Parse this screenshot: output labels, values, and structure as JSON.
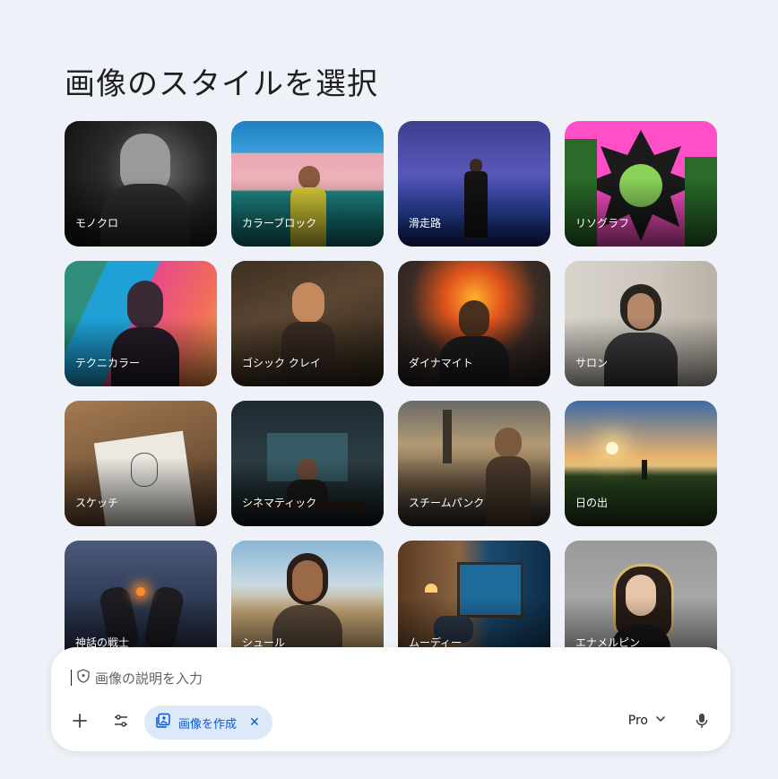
{
  "page": {
    "title": "画像のスタイルを選択"
  },
  "styles": [
    {
      "label": "モノクロ"
    },
    {
      "label": "カラーブロック"
    },
    {
      "label": "滑走路"
    },
    {
      "label": "リソグラフ"
    },
    {
      "label": "テクニカラー"
    },
    {
      "label": "ゴシック クレイ"
    },
    {
      "label": "ダイナマイト"
    },
    {
      "label": "サロン"
    },
    {
      "label": "スケッチ"
    },
    {
      "label": "シネマティック"
    },
    {
      "label": "スチームパンク"
    },
    {
      "label": "日の出"
    },
    {
      "label": "神話の戦士"
    },
    {
      "label": "シュール"
    },
    {
      "label": "ムーディー"
    },
    {
      "label": "エナメルピン"
    }
  ],
  "prompt": {
    "placeholder": "画像の説明を入力",
    "chip_label": "画像を作成",
    "model_label": "Pro"
  },
  "icons": {
    "shield": "shield-icon",
    "add": "plus-icon",
    "tools": "tune-icon",
    "image": "image-stack-icon",
    "close": "close-icon",
    "chevron": "chevron-down-icon",
    "mic": "mic-icon"
  },
  "colors": {
    "accent": "#0b57d0",
    "chip_bg": "#dde8f8",
    "page_bg": "#eef2f8"
  }
}
